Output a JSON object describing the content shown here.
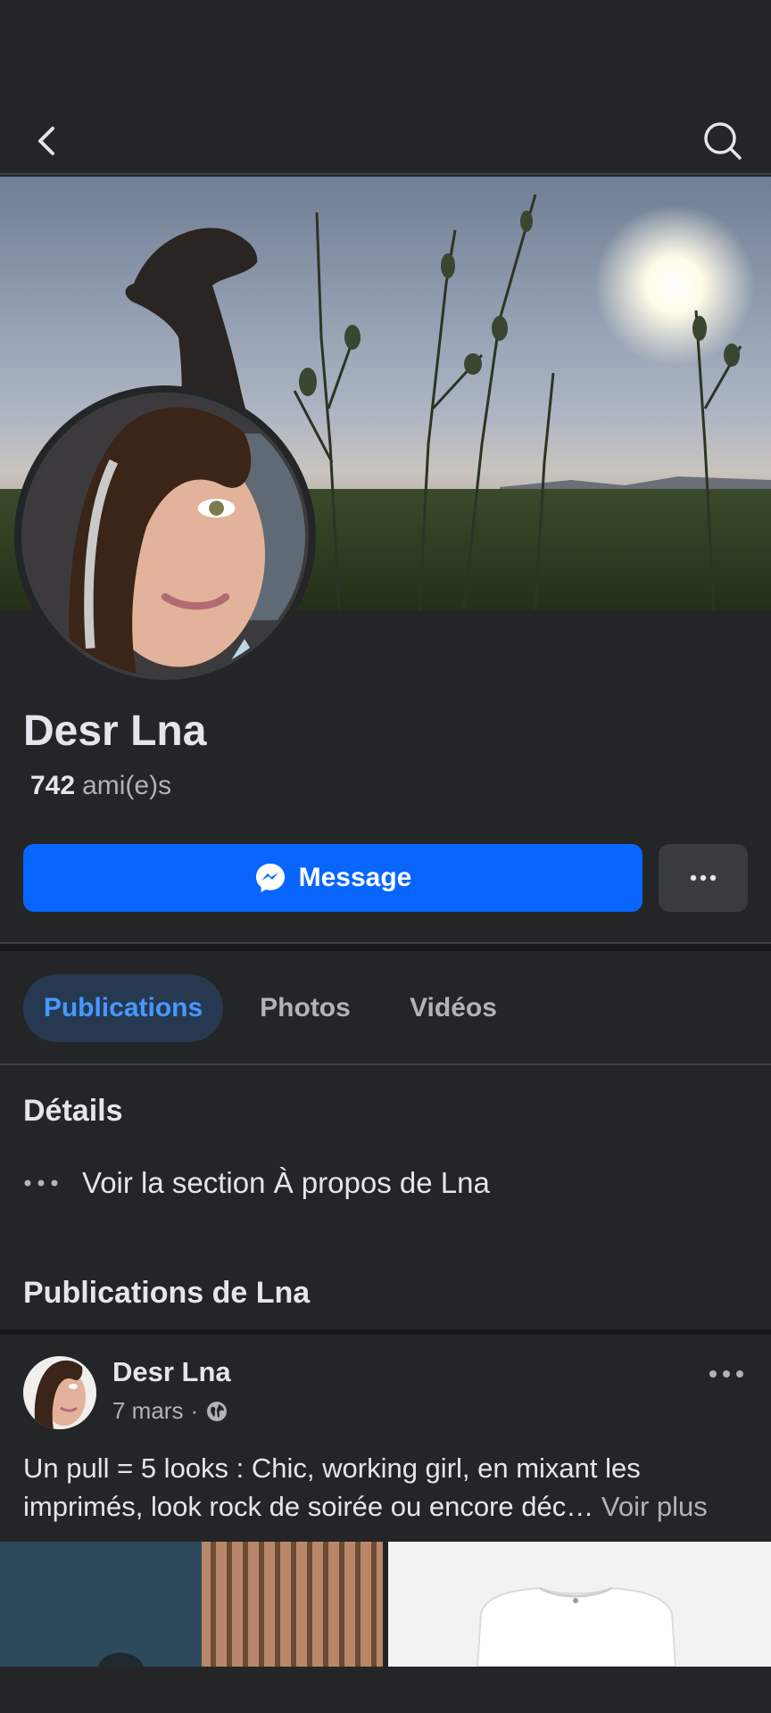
{
  "profile": {
    "name": "Desr Lna",
    "friends_count": "742",
    "friends_label": "ami(e)s"
  },
  "actions": {
    "message_label": "Message"
  },
  "tabs": [
    {
      "label": "Publications",
      "active": true
    },
    {
      "label": "Photos",
      "active": false
    },
    {
      "label": "Vidéos",
      "active": false
    }
  ],
  "details": {
    "title": "Détails",
    "about_link": "Voir la section À propos de Lna"
  },
  "posts": {
    "title": "Publications de Lna",
    "items": [
      {
        "author": "Desr Lna",
        "date": "7 mars",
        "separator": "·",
        "privacy_icon": "globe-icon",
        "text": "Un pull = 5 looks : Chic, working girl, en mixant les imprimés, look rock de soirée ou encore déc…",
        "see_more": "Voir plus"
      }
    ]
  },
  "icons": {
    "back": "chevron-left-icon",
    "search": "search-icon",
    "messenger": "messenger-icon",
    "more": "more-horizontal-icon"
  },
  "colors": {
    "background": "#242526",
    "primary_button": "#0866ff",
    "active_tab_bg": "#263951",
    "active_tab_text": "#4599ff",
    "secondary_text": "#b0b3b8"
  }
}
